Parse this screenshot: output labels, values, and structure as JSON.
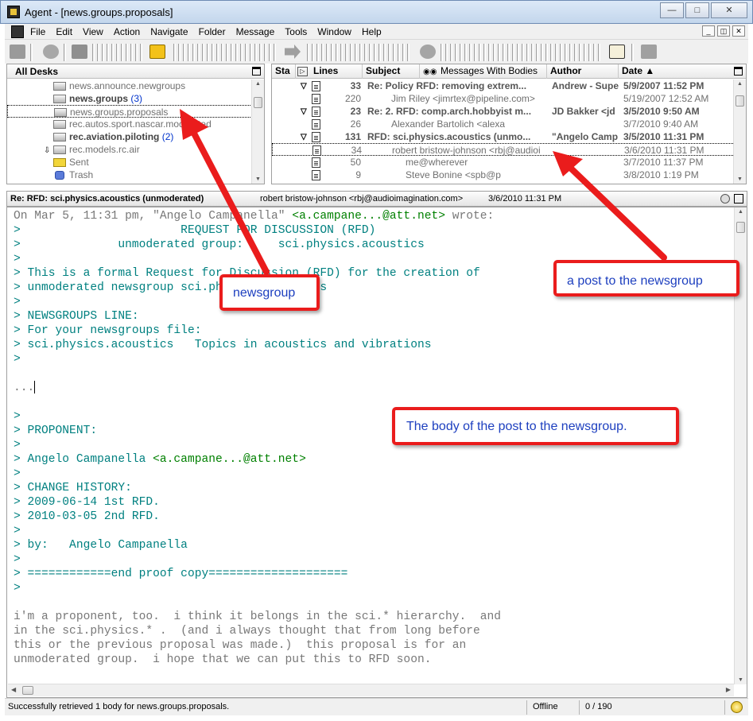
{
  "window": {
    "title": "Agent - [news.groups.proposals]",
    "minimize_glyph": "—",
    "maximize_glyph": "□",
    "close_glyph": "✕"
  },
  "menu": [
    "File",
    "Edit",
    "View",
    "Action",
    "Navigate",
    "Folder",
    "Message",
    "Tools",
    "Window",
    "Help"
  ],
  "folder_pane": {
    "title": "All Desks",
    "items": [
      {
        "name": "news.announce.newgroups",
        "count": "",
        "unread": false
      },
      {
        "name": "news.groups",
        "count": "(3)",
        "unread": true
      },
      {
        "name": "news.groups.proposals",
        "count": "",
        "unread": false
      },
      {
        "name": "rec.autos.sport.nascar.moderated",
        "count": "",
        "unread": false
      },
      {
        "name": "rec.aviation.piloting",
        "count": "(2)",
        "unread": true
      },
      {
        "name": "rec.models.rc.air",
        "count": "",
        "unread": false
      },
      {
        "name": "Sent",
        "count": "",
        "unread": false
      },
      {
        "name": "Trash",
        "count": "",
        "unread": false
      }
    ]
  },
  "message_list": {
    "columns": {
      "status": "Sta",
      "lines": "Lines",
      "subject": "Subject",
      "bodies": "Messages With Bodies",
      "author": "Author",
      "date": "Date ▲"
    },
    "rows": [
      {
        "lines": "33",
        "subject": "Re: Policy RFD: removing extrem...",
        "author": "Andrew - Supe",
        "date": "5/9/2007 11:52 PM",
        "bold": true,
        "thread": true
      },
      {
        "lines": "220",
        "subject": "Jim Riley <jimrtex@pipeline.com>",
        "author": "",
        "date": "5/19/2007 12:52 AM",
        "bold": false,
        "thread": false
      },
      {
        "lines": "23",
        "subject": "Re: 2. RFD: comp.arch.hobbyist m...",
        "author": "JD Bakker <jd",
        "date": "3/5/2010 9:50 AM",
        "bold": true,
        "thread": true
      },
      {
        "lines": "26",
        "subject": "Alexander Bartolich <alexa",
        "author": "",
        "date": "3/7/2010 9:40 AM",
        "bold": false,
        "thread": false
      },
      {
        "lines": "131",
        "subject": "RFD: sci.physics.acoustics (unmo...",
        "author": "\"Angelo Camp",
        "date": "3/5/2010 11:31 PM",
        "bold": true,
        "thread": true
      },
      {
        "lines": "34",
        "subject": "robert bristow-johnson <rbj@audioi",
        "author": "",
        "date": "3/6/2010 11:31 PM",
        "bold": false,
        "thread": false
      },
      {
        "lines": "50",
        "subject": "me@wherever",
        "author": "",
        "date": "3/7/2010 11:37 PM",
        "bold": false,
        "thread": false
      },
      {
        "lines": "9",
        "subject": "Steve Bonine <spb@p",
        "author": "",
        "date": "3/8/2010 1:19 PM",
        "bold": false,
        "thread": false
      }
    ]
  },
  "message_header": {
    "subject": "Re: RFD: sci.physics.acoustics (unmoderated)",
    "author": "robert bristow-johnson <rbj@audioimagination.com>",
    "date": "3/6/2010 11:31 PM"
  },
  "body_lines": [
    {
      "t": "On Mar 5, 11:31 pm, \"Angelo Campanella\" ",
      "e": "<a.campane...@att.net>",
      "a": " wrote:",
      "k": "header"
    },
    {
      "t": ">                       REQUEST FOR DISCUSSION (RFD)",
      "k": "quoted"
    },
    {
      "t": ">              unmoderated group:     sci.physics.acoustics",
      "k": "quoted"
    },
    {
      "t": ">",
      "k": "quoted"
    },
    {
      "t": "> This is a formal Request for Discussion (RFD) for the creation of",
      "k": "quoted"
    },
    {
      "t": "> unmoderated newsgroup sci.physics.acoustics",
      "k": "quoted"
    },
    {
      "t": ">",
      "k": "quoted"
    },
    {
      "t": "> NEWSGROUPS LINE:",
      "k": "quoted"
    },
    {
      "t": "> For your newsgroups file:",
      "k": "quoted"
    },
    {
      "t": "> sci.physics.acoustics   Topics in acoustics and vibrations",
      "k": "quoted"
    },
    {
      "t": ">",
      "k": "quoted"
    },
    {
      "t": "",
      "k": "plain"
    },
    {
      "t": "...",
      "k": "plain",
      "cursor": true
    },
    {
      "t": "",
      "k": "plain"
    },
    {
      "t": ">",
      "k": "quoted"
    },
    {
      "t": "> PROPONENT:",
      "k": "quoted"
    },
    {
      "t": ">",
      "k": "quoted"
    },
    {
      "t": "> Angelo Campanella ",
      "e": "<a.campane...@att.net>",
      "a": "",
      "k": "quoted"
    },
    {
      "t": ">",
      "k": "quoted"
    },
    {
      "t": "> CHANGE HISTORY:",
      "k": "quoted"
    },
    {
      "t": "> 2009-06-14 1st RFD.",
      "k": "quoted"
    },
    {
      "t": "> 2010-03-05 2nd RFD.",
      "k": "quoted"
    },
    {
      "t": ">",
      "k": "quoted"
    },
    {
      "t": "> by:   Angelo Campanella",
      "k": "quoted"
    },
    {
      "t": ">",
      "k": "quoted"
    },
    {
      "t": "> ============end proof copy====================",
      "k": "quoted"
    },
    {
      "t": ">",
      "k": "quoted"
    },
    {
      "t": "",
      "k": "plain"
    },
    {
      "t": "i'm a proponent, too.  i think it belongs in the sci.* hierarchy.  and",
      "k": "plain"
    },
    {
      "t": "in the sci.physics.* .  (and i always thought that from long before",
      "k": "plain"
    },
    {
      "t": "this or the previous proposal was made.)  this proposal is for an",
      "k": "plain"
    },
    {
      "t": "unmoderated group.  i hope that we can put this to RFD soon.",
      "k": "plain"
    }
  ],
  "statusbar": {
    "message": "Successfully retrieved 1 body for news.groups.proposals.",
    "online_status": "Offline",
    "count": "0 / 190"
  },
  "callouts": {
    "newsgroup": "newsgroup",
    "post": "a post to the newsgroup",
    "body": "The body of the post to the newsgroup."
  },
  "colors": {
    "callout_border": "#ea1c1c",
    "callout_text": "#1d3fbf",
    "quoted_text": "#008080",
    "email_text": "#008000"
  }
}
